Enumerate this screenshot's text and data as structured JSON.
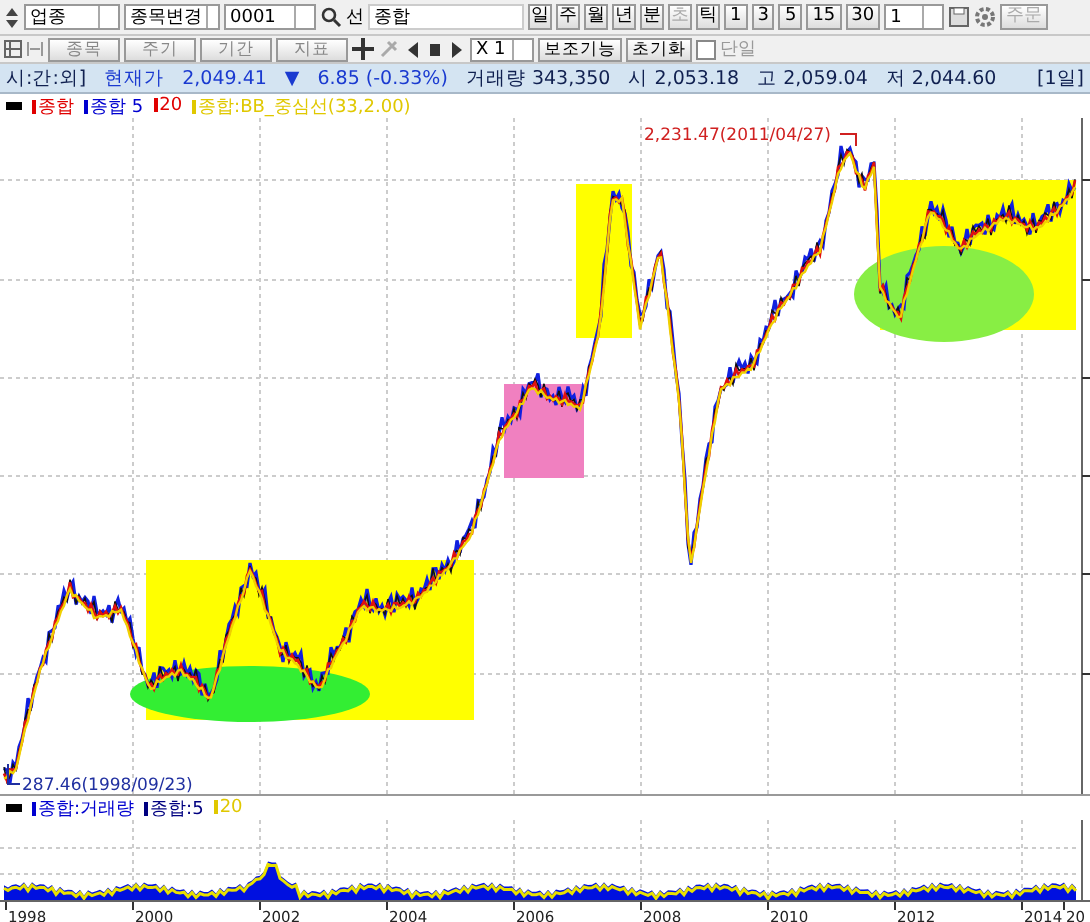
{
  "toolbar": {
    "market": "업종",
    "change": "종목변경",
    "code": "0001",
    "prefix": "선",
    "name": "종합",
    "periods": [
      {
        "label": "일",
        "disabled": false
      },
      {
        "label": "주",
        "disabled": false
      },
      {
        "label": "월",
        "disabled": false
      },
      {
        "label": "년",
        "disabled": false
      },
      {
        "label": "분",
        "disabled": false
      },
      {
        "label": "초",
        "disabled": true
      },
      {
        "label": "틱",
        "disabled": false
      }
    ],
    "intervals": [
      "1",
      "3",
      "5",
      "15",
      "30"
    ],
    "count": "1",
    "order": "주문"
  },
  "toolbar2": {
    "buttons": [
      "종목",
      "주기",
      "기간",
      "지표"
    ],
    "multiplier": "X 1",
    "aux": "보조기능",
    "reset": "초기화",
    "single": {
      "label": "단일",
      "checked": false
    }
  },
  "quote": {
    "mode": "시:간:외]",
    "label": "현재가",
    "price": "2,049.41",
    "arrow": "▼",
    "change": "6.85",
    "rate": "(-0.33%)",
    "volume": "거래량 343,350",
    "open": "시 2,053.18",
    "high": "고 2,059.04",
    "low": "저 2,044.60",
    "period": "[1일]"
  },
  "legend": [
    {
      "label": "종합",
      "color": "#e00000"
    },
    {
      "label": "종합 5",
      "color": "#0000d0"
    },
    {
      "label": "20",
      "color": "#e00000"
    },
    {
      "label": "종합:BB_중심선(33,2.00)",
      "color": "#e0c800"
    }
  ],
  "annotations": {
    "high": "2,231.47(2011/04/27)",
    "low": "287.46(1998/09/23)"
  },
  "volume_legend": [
    {
      "label": "종합:거래량",
      "color": "#0000d0"
    },
    {
      "label": "종합:5",
      "color": "#000080"
    },
    {
      "label": "20",
      "color": "#e0c800"
    }
  ],
  "x_axis": [
    "1998",
    "2000",
    "2002",
    "2004",
    "2006",
    "2008",
    "2010",
    "2012",
    "2014",
    "20"
  ]
}
